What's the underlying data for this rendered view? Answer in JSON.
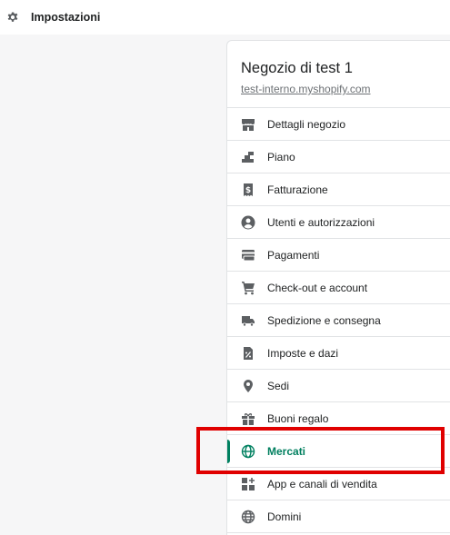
{
  "header": {
    "title": "Impostazioni",
    "icon": "gear-icon"
  },
  "store": {
    "name": "Negozio di test 1",
    "domain": "test-interno.myshopify.com"
  },
  "nav": {
    "items": [
      {
        "label": "Dettagli negozio",
        "icon": "store-icon"
      },
      {
        "label": "Piano",
        "icon": "plan-icon"
      },
      {
        "label": "Fatturazione",
        "icon": "billing-icon"
      },
      {
        "label": "Utenti e autorizzazioni",
        "icon": "user-icon"
      },
      {
        "label": "Pagamenti",
        "icon": "payments-icon"
      },
      {
        "label": "Check-out e account",
        "icon": "cart-icon"
      },
      {
        "label": "Spedizione e consegna",
        "icon": "truck-icon"
      },
      {
        "label": "Imposte e dazi",
        "icon": "tax-icon"
      },
      {
        "label": "Sedi",
        "icon": "location-icon"
      },
      {
        "label": "Buoni regalo",
        "icon": "gift-icon"
      },
      {
        "label": "Mercati",
        "icon": "globe-icon",
        "active": true
      },
      {
        "label": "App e canali di vendita",
        "icon": "apps-icon"
      },
      {
        "label": "Domini",
        "icon": "domain-icon"
      }
    ]
  },
  "colors": {
    "accent": "#008060",
    "active_text": "#007f5f",
    "annotation": "#e00000",
    "icon": "#5c5f62"
  }
}
